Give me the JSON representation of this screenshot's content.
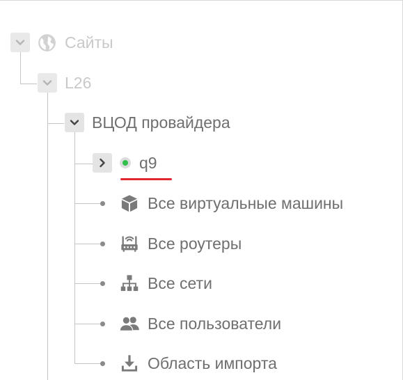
{
  "tree": {
    "sites": {
      "label": "Сайты",
      "icon": "globe-icon"
    },
    "l26": {
      "label": "L26"
    },
    "provider": {
      "label": "ВЦОД провайдера"
    },
    "q9": {
      "label": "q9",
      "status_color": "#2fbf4a",
      "highlight_color": "#e0262e"
    },
    "children": [
      {
        "label": "Все виртуальные машины",
        "icon": "cube-icon"
      },
      {
        "label": "Все роутеры",
        "icon": "router-icon"
      },
      {
        "label": "Все сети",
        "icon": "network-icon"
      },
      {
        "label": "Все пользователи",
        "icon": "users-icon"
      },
      {
        "label": "Область импорта",
        "icon": "download-icon"
      }
    ]
  }
}
